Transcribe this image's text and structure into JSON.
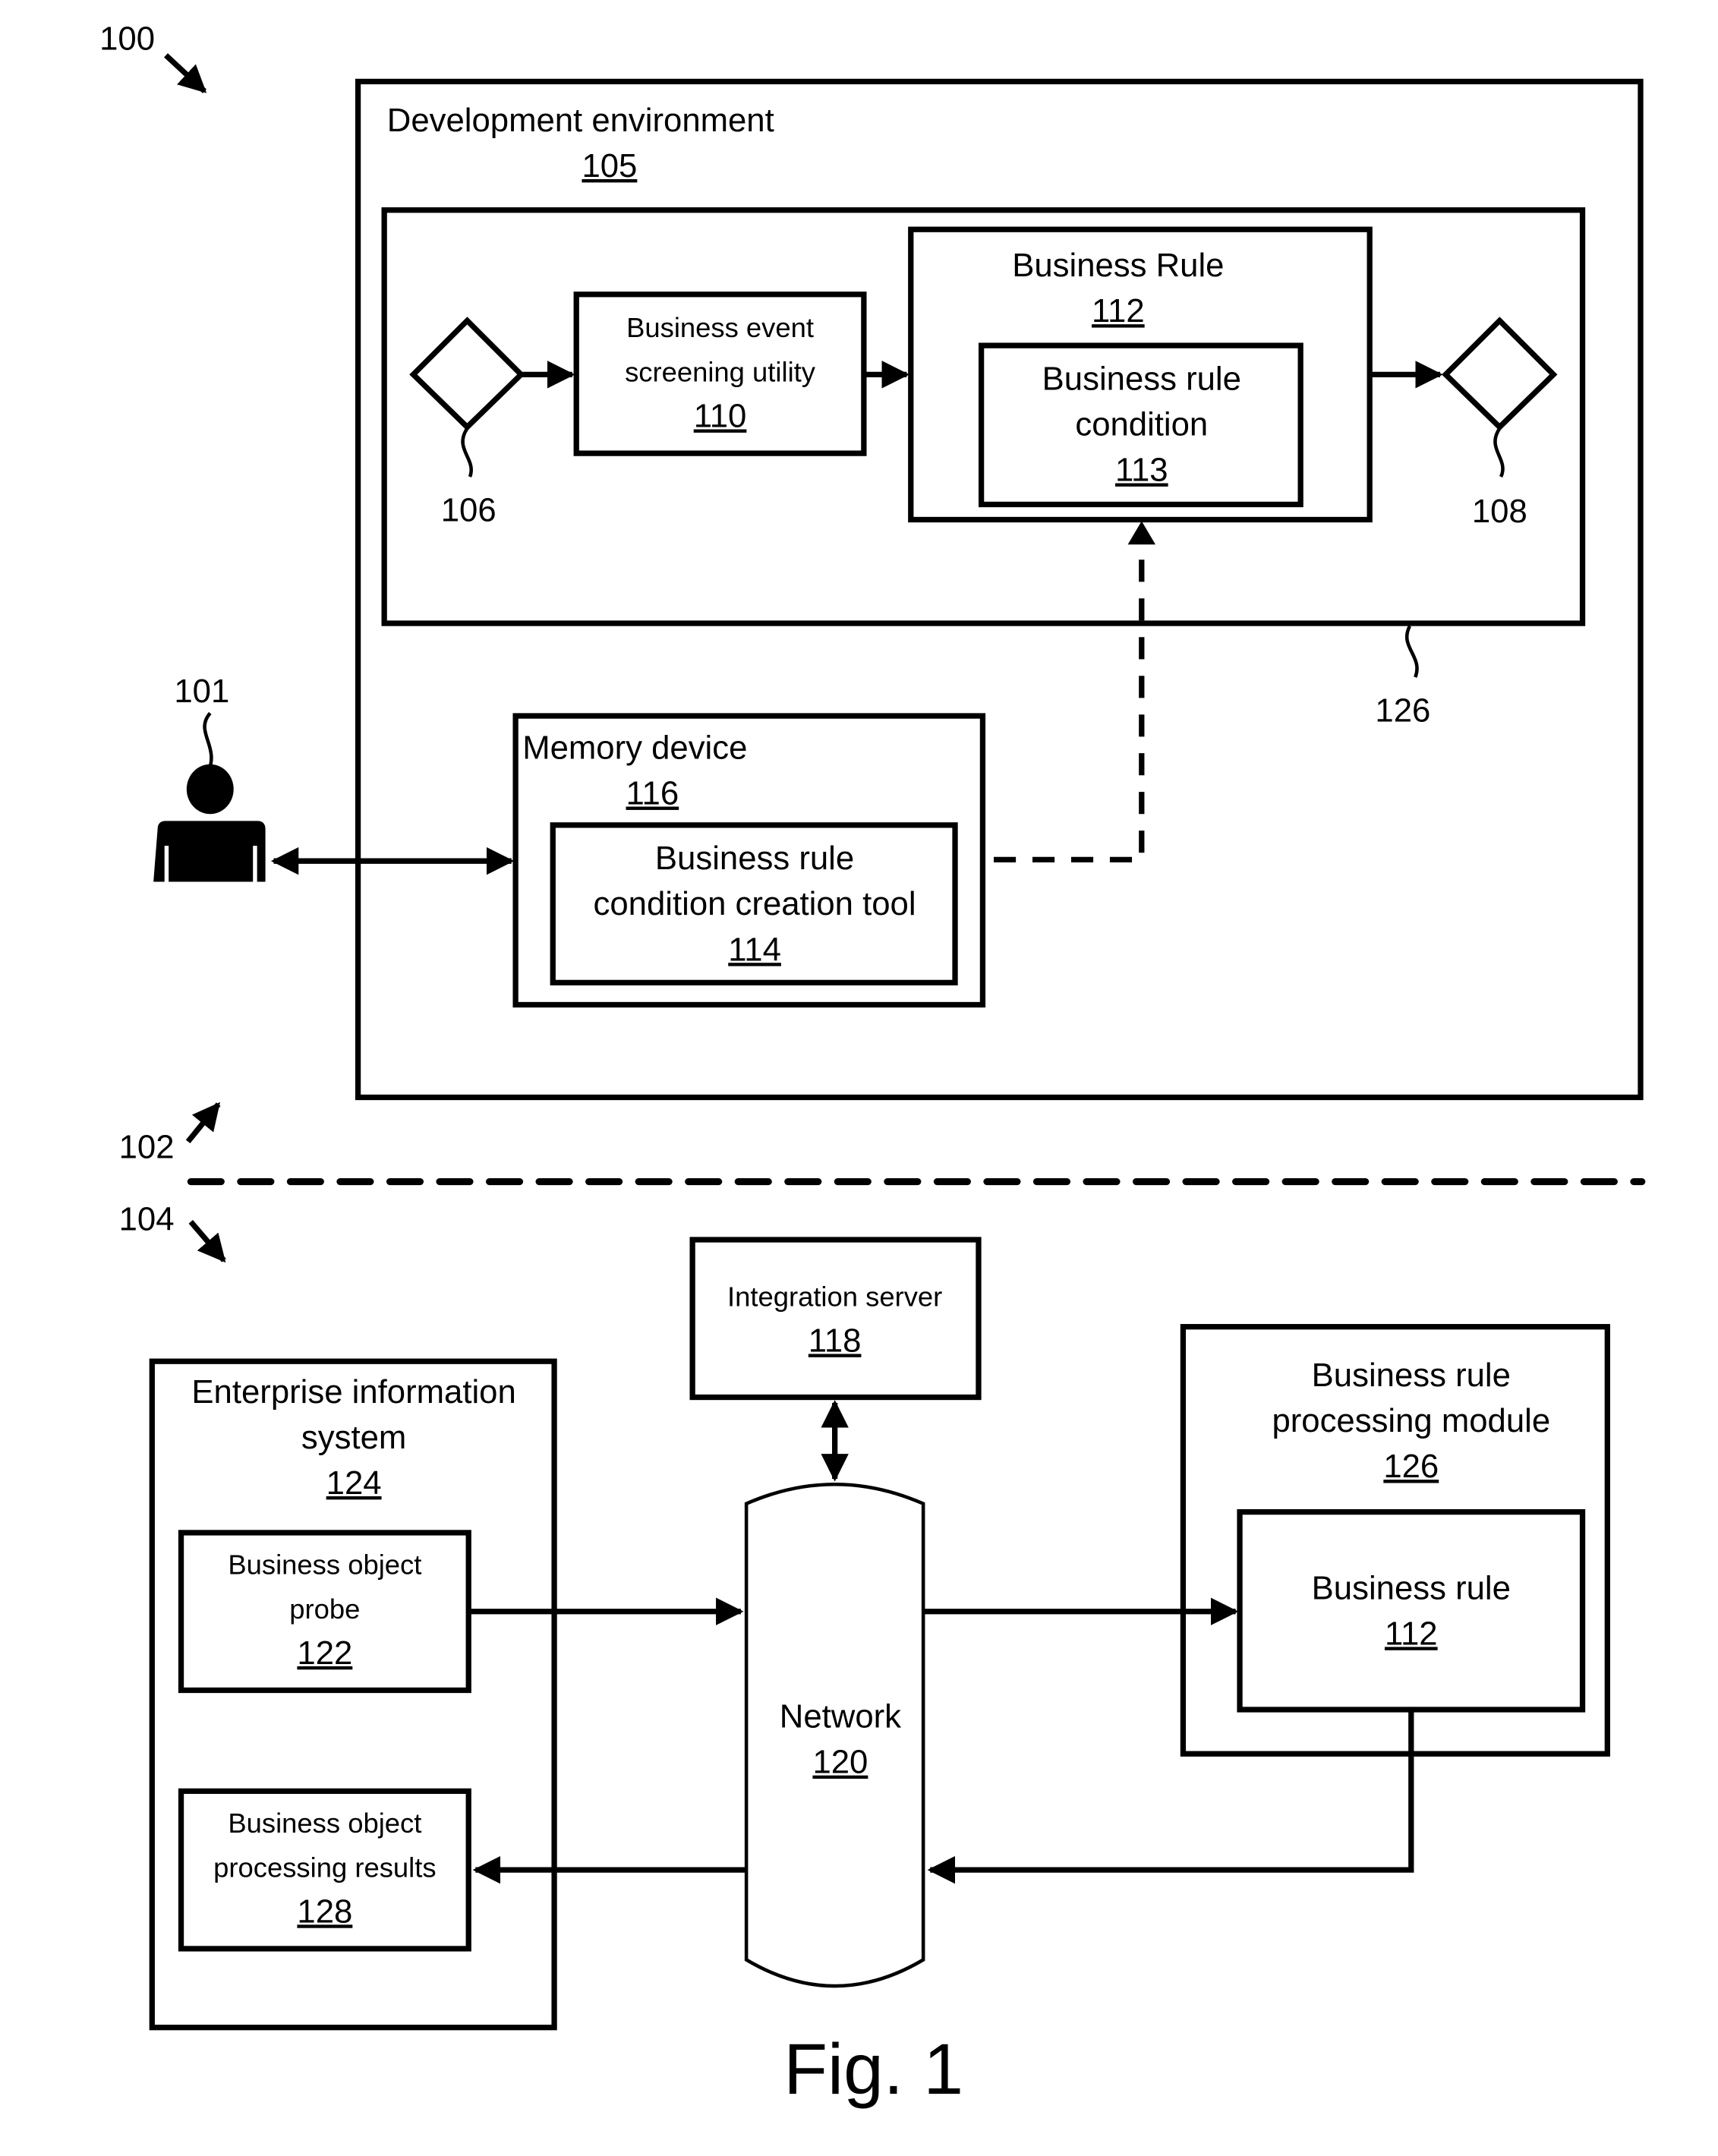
{
  "figure": {
    "caption": "Fig. 1",
    "ref_system": "100",
    "ref_design_time": "102",
    "ref_run_time": "104"
  },
  "development_environment": {
    "title": "Development environment",
    "ref": "105",
    "process_ref": "126",
    "start_event_ref": "106",
    "end_event_ref": "108",
    "screening_utility": {
      "line1": "Business event",
      "line2": "screening utility",
      "ref": "110"
    },
    "business_rule": {
      "title": "Business Rule",
      "ref": "112",
      "condition": {
        "line1": "Business rule",
        "line2": "condition",
        "ref": "113"
      }
    },
    "user_ref": "101",
    "memory_device": {
      "title": "Memory device",
      "ref": "116",
      "tool": {
        "line1": "Business rule",
        "line2": "condition creation tool",
        "ref": "114"
      }
    }
  },
  "runtime": {
    "integration_server": {
      "title": "Integration server",
      "ref": "118"
    },
    "network": {
      "title": "Network",
      "ref": "120"
    },
    "enterprise_info_system": {
      "line1": "Enterprise information",
      "line2": "system",
      "ref": "124",
      "probe": {
        "line1": "Business object",
        "line2": "probe",
        "ref": "122"
      },
      "results": {
        "line1": "Business object",
        "line2": "processing results",
        "ref": "128"
      }
    },
    "processing_module": {
      "line1": "Business rule",
      "line2": "processing module",
      "ref": "126",
      "rule": {
        "title": "Business rule",
        "ref": "112"
      }
    }
  }
}
